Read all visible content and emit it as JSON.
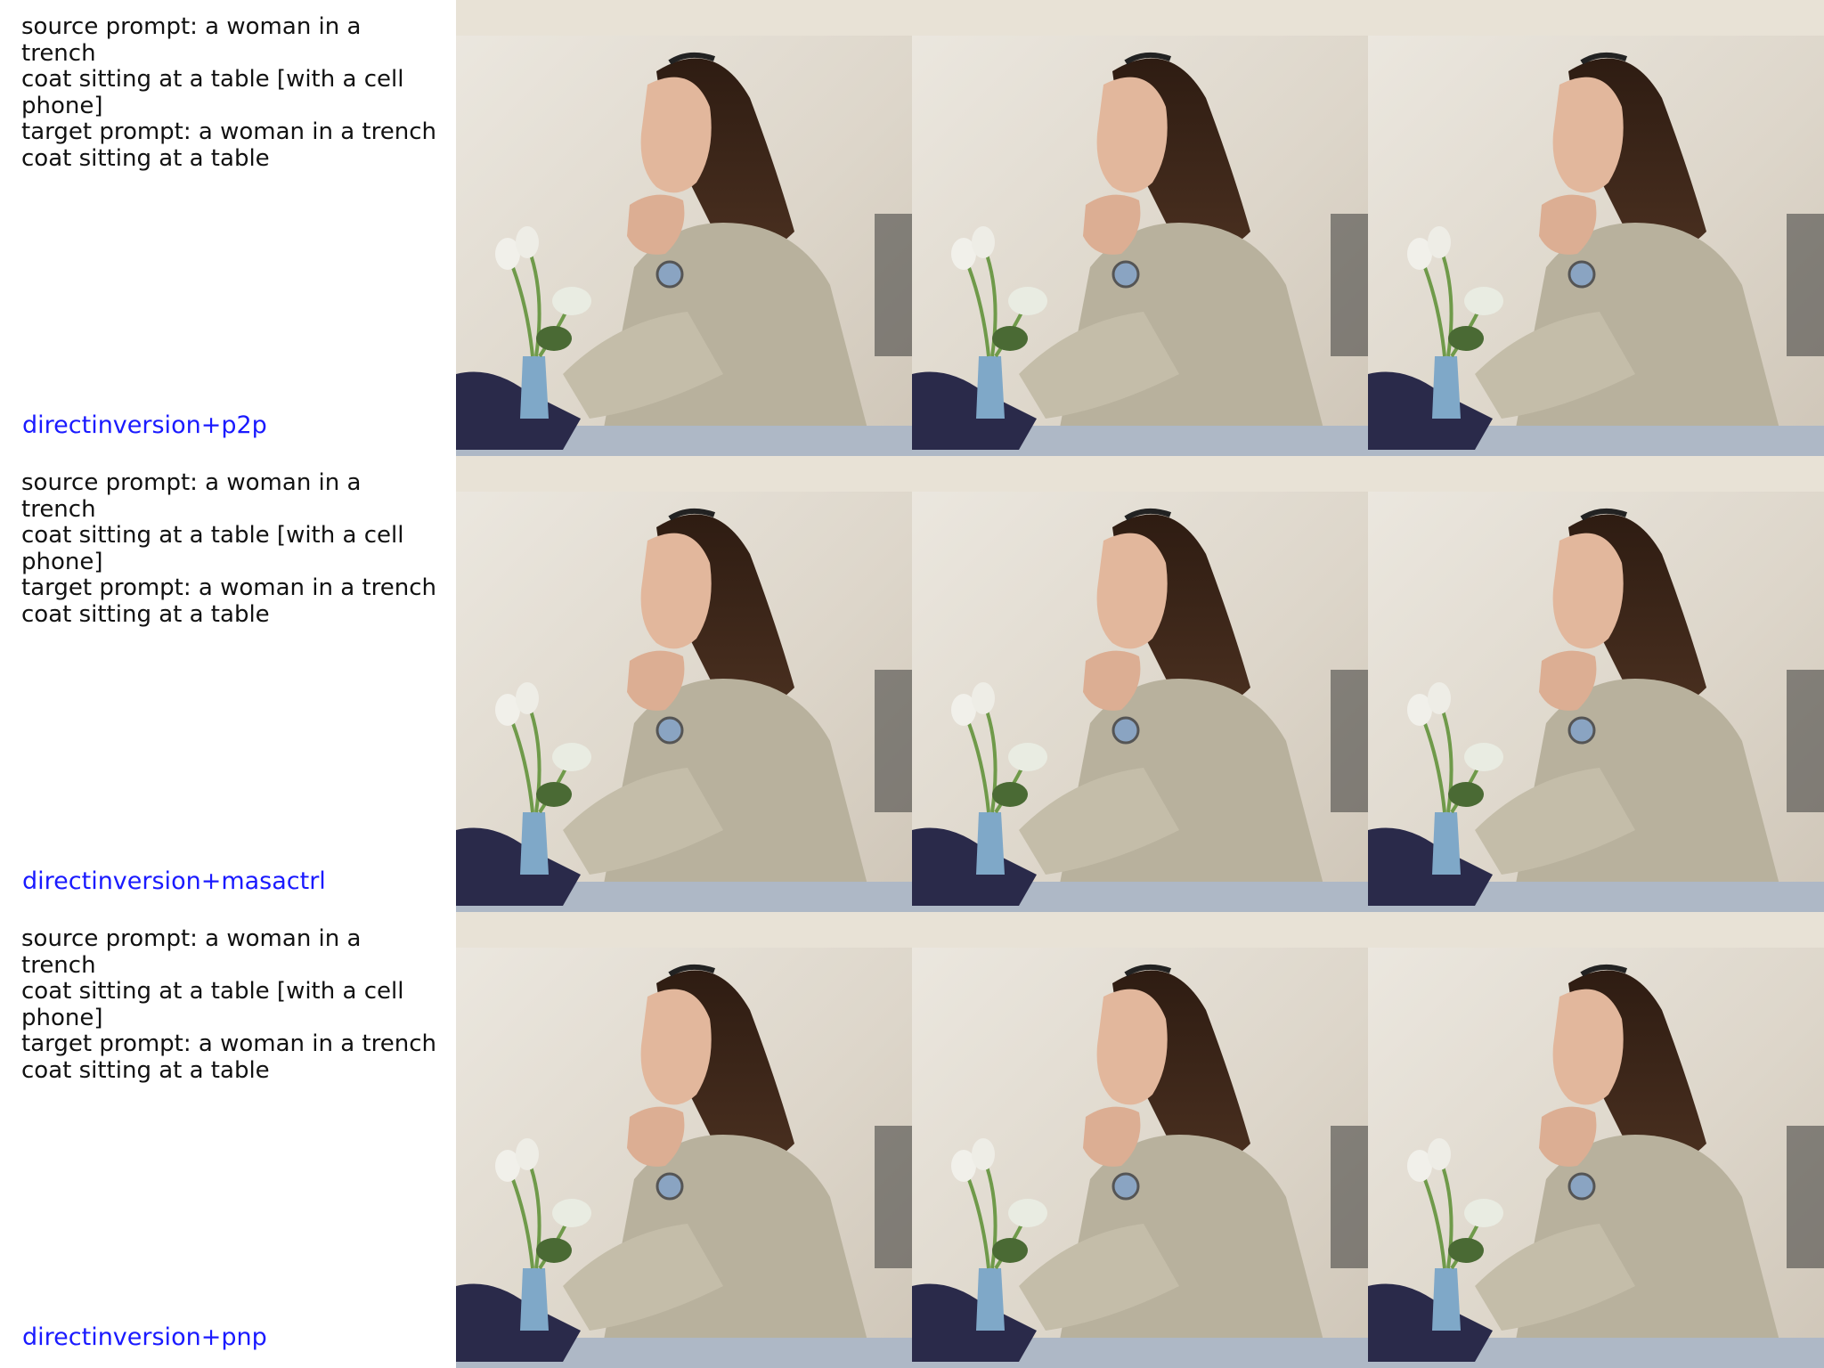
{
  "rows": [
    {
      "prompt": "source prompt: a woman in a trench\ncoat sitting at a table [with a cell\nphone]\ntarget prompt: a woman in a trench\ncoat sitting at a table",
      "method": "directinversion+p2p",
      "images": [
        "photo-woman-trench-coat",
        "photo-woman-trench-coat",
        "photo-woman-trench-coat"
      ]
    },
    {
      "prompt": "source prompt: a woman in a trench\ncoat sitting at a table [with a cell\nphone]\ntarget prompt: a woman in a trench\ncoat sitting at a table",
      "method": "directinversion+masactrl",
      "images": [
        "photo-woman-trench-coat",
        "photo-woman-trench-coat",
        "photo-woman-trench-coat"
      ]
    },
    {
      "prompt": "source prompt: a woman in a trench\ncoat sitting at a table [with a cell\nphone]\ntarget prompt: a woman in a trench\ncoat sitting at a table",
      "method": "directinversion+pnp",
      "images": [
        "photo-woman-trench-coat",
        "photo-woman-trench-coat",
        "photo-woman-trench-coat"
      ]
    }
  ],
  "colors": {
    "method_label": "#1a1aff",
    "wall": "#ddd6ca",
    "coat": "#b8b19d",
    "hair": "#4a3020",
    "table": "#aeb8c6",
    "bag": "#2a2a4a",
    "vase": "#7fa8c8"
  }
}
